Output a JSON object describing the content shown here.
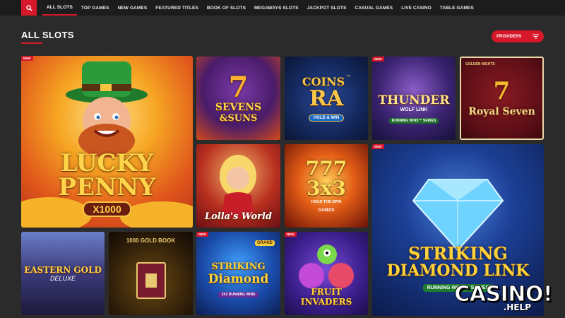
{
  "nav": {
    "items": [
      "ALL SLOTS",
      "TOP GAMES",
      "NEW GAMES",
      "FEATURED TITLES",
      "BOOK OF SLOTS",
      "MEGAWAYS SLOTS",
      "JACKPOT SLOTS",
      "CASUAL GAMES",
      "LIVE CASINO",
      "TABLE GAMES"
    ]
  },
  "page": {
    "title": "ALL SLOTS"
  },
  "providers": {
    "label": "PROVIDERS"
  },
  "badge_label": "NEW",
  "games": {
    "lucky_penny": {
      "line1": "LUCKY",
      "line2": "PENNY",
      "line3": "X1000"
    },
    "sevens_suns": {
      "line1": "7",
      "line2": "SEVENS",
      "line3": "&SUNS"
    },
    "coins_ra": {
      "line1": "COINS",
      "line2": "RA",
      "line3": "HOLD & WIN",
      "tm": "™"
    },
    "thunder_wolf": {
      "line1": "THUNDER",
      "line2": "WOLF LINK",
      "line3": "RUNNING WINS™ SERIES"
    },
    "royal_seven": {
      "line1": "GOLDEN NIGHTS",
      "line2": "7",
      "line3": "Royal Seven"
    },
    "lollas_world": {
      "line1": "Lolla's World"
    },
    "three_x_three": {
      "line1": "777",
      "line2": "3x3",
      "line3": "HOLD THE SPIN",
      "line4": "GAMZIX"
    },
    "striking_diamond_link": {
      "line1": "STRIKING",
      "line2": "DIAMOND LINK",
      "line3": "RUNNING WINS™ SERIES"
    },
    "eastern_gold": {
      "line1": "EASTERN GOLD",
      "line2": "DELUXE"
    },
    "book_tile": {
      "line1": "1000 GOLD BOOK"
    },
    "striking_diamond": {
      "line1": "STRIKING",
      "line2": "Diamond",
      "line3": "3X3 RUNNING WINS",
      "line4": "GRAND"
    },
    "fruit_invaders": {
      "line1": "FRUIT INVADERS"
    }
  },
  "watermark": {
    "main": "CASINO!",
    "sub": ".HELP"
  },
  "colors": {
    "accent": "#d7182a",
    "nav_bg": "#1c1c1c",
    "page_bg": "#2b2b2b"
  }
}
